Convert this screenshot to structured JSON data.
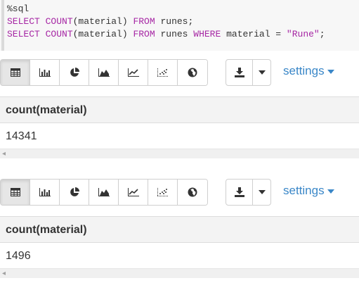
{
  "code": {
    "magic": "%sql",
    "line1": {
      "kw1": "SELECT COUNT",
      "p1": "(material) ",
      "kw2": "FROM",
      "p2": " runes;"
    },
    "line2": {
      "kw1": "SELECT COUNT",
      "p1": "(material) ",
      "kw2": "FROM",
      "p2": " runes ",
      "kw3": "WHERE",
      "p3": " material = ",
      "str": "\"Rune\"",
      "p4": ";"
    }
  },
  "toolbar": {
    "buttons": [
      "table-icon",
      "bar-chart-icon",
      "pie-chart-icon",
      "area-chart-icon",
      "line-chart-icon",
      "scatter-chart-icon",
      "map-icon"
    ],
    "active_button": "table-icon",
    "download_icon": "download-icon",
    "caret_icon": "caret-down-icon",
    "settings_label": "settings"
  },
  "results": [
    {
      "column": "count(material)",
      "value": "14341"
    },
    {
      "column": "count(material)",
      "value": "1496"
    }
  ],
  "colors": {
    "accent": "#3a87c8",
    "keyword": "#a626a4",
    "header_bg": "#f3f3f3"
  }
}
